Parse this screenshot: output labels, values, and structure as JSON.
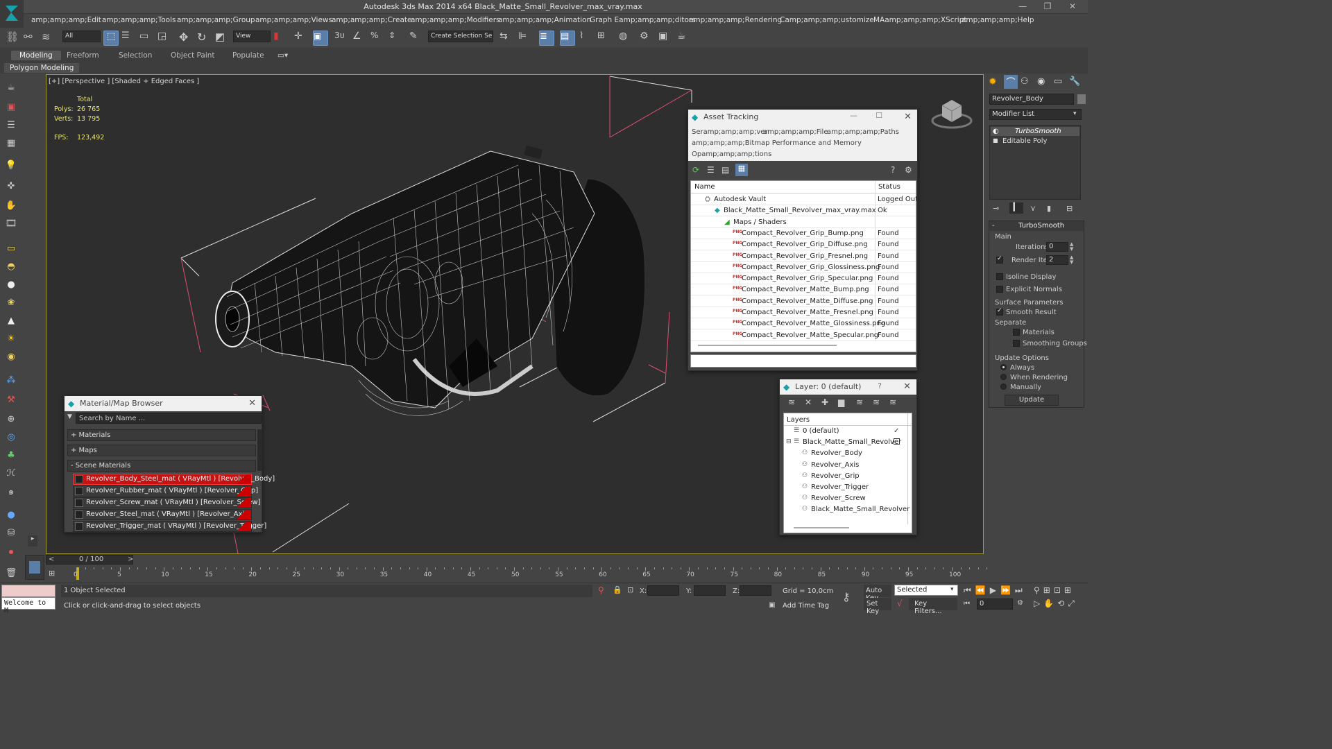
{
  "app": {
    "title": "Autodesk 3ds Max  2014 x64     Black_Matte_Small_Revolver_max_vray.max"
  },
  "menu": [
    "amp;amp;amp;Edit",
    "amp;amp;amp;Tools",
    "amp;amp;amp;Group",
    "amp;amp;amp;Views",
    "amp;amp;amp;Create",
    "amp;amp;amp;Modifiers",
    "amp;amp;amp;Animation",
    "Graph Eamp;amp;amp;ditors",
    "amp;amp;amp;Rendering",
    "Camp;amp;amp;ustomize",
    "MAamp;amp;amp;XScript",
    "amp;amp;amp;Help"
  ],
  "toolbar": {
    "filter": "All",
    "view": "View",
    "selection_set": "Create Selection Se"
  },
  "ribbon": {
    "tabs": [
      "Modeling",
      "Freeform",
      "Selection",
      "Object Paint",
      "Populate"
    ],
    "sub": "Polygon Modeling"
  },
  "viewport": {
    "label": "[+] [Perspective ] [Shaded + Edged Faces ]",
    "total": "Total",
    "polys_label": "Polys:",
    "polys": "26 765",
    "verts_label": "Verts:",
    "verts": "13 795",
    "fps_label": "FPS:",
    "fps": "123,492"
  },
  "asset": {
    "title": "Asset Tracking",
    "menu1": [
      "Seramp;amp;amp;ver",
      "amp;amp;amp;File",
      "amp;amp;amp;Paths"
    ],
    "menu2": "amp;amp;amp;Bitmap Performance and Memory",
    "menu3": "Opamp;amp;amp;tions",
    "col_name": "Name",
    "col_status": "Status",
    "rows": [
      {
        "n": "Autodesk Vault",
        "s": "Logged Out"
      },
      {
        "n": "Black_Matte_Small_Revolver_max_vray.max",
        "s": "Ok"
      },
      {
        "n": "Maps / Shaders",
        "s": ""
      },
      {
        "n": "Compact_Revolver_Grip_Bump.png",
        "s": "Found"
      },
      {
        "n": "Compact_Revolver_Grip_Diffuse.png",
        "s": "Found"
      },
      {
        "n": "Compact_Revolver_Grip_Fresnel.png",
        "s": "Found"
      },
      {
        "n": "Compact_Revolver_Grip_Glossiness.png",
        "s": "Found"
      },
      {
        "n": "Compact_Revolver_Grip_Specular.png",
        "s": "Found"
      },
      {
        "n": "Compact_Revolver_Matte_Bump.png",
        "s": "Found"
      },
      {
        "n": "Compact_Revolver_Matte_Diffuse.png",
        "s": "Found"
      },
      {
        "n": "Compact_Revolver_Matte_Fresnel.png",
        "s": "Found"
      },
      {
        "n": "Compact_Revolver_Matte_Glossiness.png",
        "s": "Found"
      },
      {
        "n": "Compact_Revolver_Matte_Specular.png",
        "s": "Found"
      }
    ]
  },
  "matbrowser": {
    "title": "Material/Map Browser",
    "search": "Search by Name ...",
    "materials": "+ Materials",
    "maps": "+ Maps",
    "scene": "- Scene Materials",
    "items": [
      "Revolver_Body_Steel_mat ( VRayMtl ) [Revolver_Body]",
      "Revolver_Rubber_mat ( VRayMtl ) [Revolver_Grip]",
      "Revolver_Screw_mat ( VRayMtl ) [Revolver_Screw]",
      "Revolver_Steel_mat ( VRayMtl ) [Revolver_Axis]",
      "Revolver_Trigger_mat ( VRayMtl ) [Revolver_Trigger]"
    ]
  },
  "layer": {
    "title": "Layer: 0 (default)",
    "header": "Layers",
    "items": [
      "0 (default)",
      "Black_Matte_Small_Revolver",
      "Revolver_Body",
      "Revolver_Axis",
      "Revolver_Grip",
      "Revolver_Trigger",
      "Revolver_Screw",
      "Black_Matte_Small_Revolver"
    ]
  },
  "cmd": {
    "object": "Revolver_Body",
    "modlist": "Modifier List",
    "stack": [
      "TurboSmooth",
      "Editable Poly"
    ],
    "rollout": "TurboSmooth",
    "main": "Main",
    "iterations_label": "Iterations:",
    "iterations": "0",
    "render_iters_label": "Render Iters:",
    "render_iters": "2",
    "isoline": "Isoline Display",
    "explicit": "Explicit Normals",
    "surface": "Surface Parameters",
    "smooth": "Smooth Result",
    "separate": "Separate",
    "materials": "Materials",
    "smoothing": "Smoothing Groups",
    "update_opts": "Update Options",
    "always": "Always",
    "when": "When Rendering",
    "manually": "Manually",
    "update_btn": "Update"
  },
  "timeline": {
    "frame": "0 / 100",
    "ticks": [
      "0",
      "5",
      "10",
      "15",
      "20",
      "25",
      "30",
      "35",
      "40",
      "45",
      "50",
      "55",
      "60",
      "65",
      "70",
      "75",
      "80",
      "85",
      "90",
      "95",
      "100"
    ]
  },
  "status": {
    "welcome": "Welcome to M",
    "selected": "1 Object Selected",
    "prompt": "Click or click-and-drag to select objects",
    "x": "X:",
    "y": "Y:",
    "z": "Z:",
    "grid": "Grid = 10,0cm",
    "add_time_tag": "Add Time Tag",
    "auto_key": "Auto Key",
    "set_key": "Set Key",
    "key_mode": "Selected",
    "key_filters": "Key Filters...",
    "frame": "0"
  }
}
